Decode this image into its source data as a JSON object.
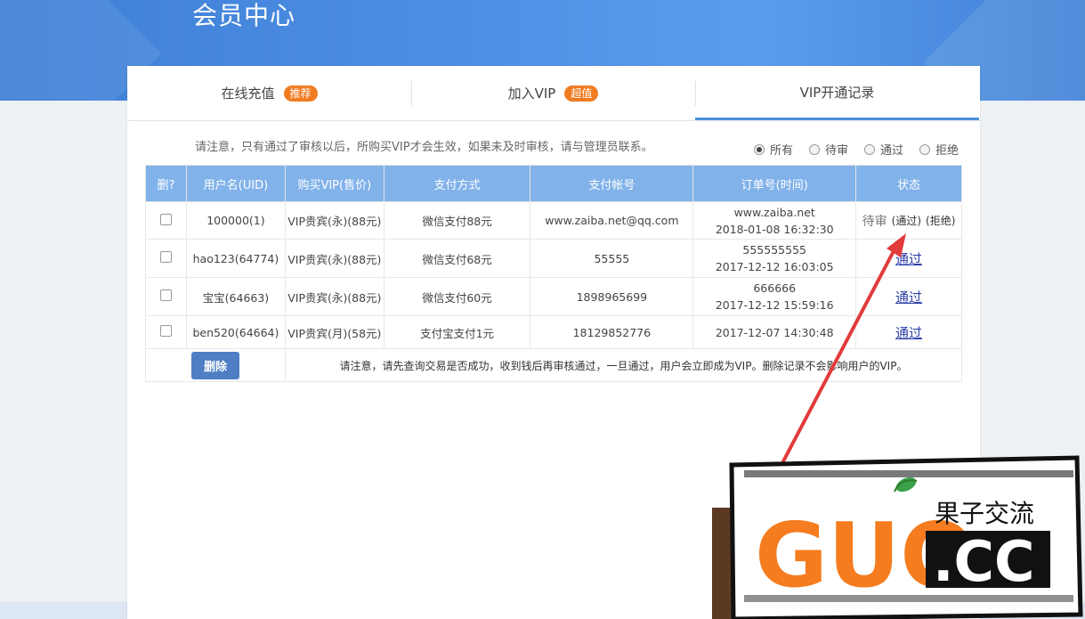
{
  "header": {
    "title": "会员中心"
  },
  "tabs": [
    {
      "label": "在线充值",
      "badge": "推荐"
    },
    {
      "label": "加入VIP",
      "badge": "超值"
    },
    {
      "label": "VIP开通记录",
      "badge": ""
    }
  ],
  "notice": "请注意，只有通过了审核以后，所购买VIP才会生效，如果未及时审核，请与管理员联系。",
  "filters": [
    {
      "label": "所有",
      "selected": true
    },
    {
      "label": "待审",
      "selected": false
    },
    {
      "label": "通过",
      "selected": false
    },
    {
      "label": "拒绝",
      "selected": false
    }
  ],
  "table": {
    "headers": [
      "删?",
      "用户名(UID)",
      "购买VIP(售价)",
      "支付方式",
      "支付帐号",
      "订单号(时间)",
      "状态"
    ],
    "rows": [
      {
        "user": "100000(1)",
        "vip": "VIP贵宾(永)(88元)",
        "pay_method": "微信支付88元",
        "account": "www.zaiba.net@qq.com",
        "order_no": "www.zaiba.net",
        "order_time": "2018-01-08 16:32:30",
        "status": "待审",
        "action_pass": "(通过)",
        "action_reject": "(拒绝)"
      },
      {
        "user": "hao123(64774)",
        "vip": "VIP贵宾(永)(88元)",
        "pay_method": "微信支付68元",
        "account": "55555",
        "order_no": "555555555",
        "order_time": "2017-12-12 16:03:05",
        "status": "通过"
      },
      {
        "user": "宝宝(64663)",
        "vip": "VIP贵宾(永)(88元)",
        "pay_method": "微信支付60元",
        "account": "1898965699",
        "order_no": "666666",
        "order_time": "2017-12-12 15:59:16",
        "status": "通过"
      },
      {
        "user": "ben520(64664)",
        "vip": "VIP贵宾(月)(58元)",
        "pay_method": "支付宝支付1元",
        "account": "18129852776",
        "order_no": "",
        "order_time": "2017-12-07 14:30:48",
        "status": "通过"
      }
    ],
    "delete_label": "删除",
    "footer_note": "请注意，请先查询交易是否成功，收到钱后再审核通过，一旦通过，用户会立即成为VIP。删除记录不会影响用户的VIP。"
  },
  "watermark": {
    "text_big": "GUO",
    "text_cn": "果子交流",
    "text_domain": ".CC"
  },
  "colors": {
    "banner": "#4e90e4",
    "table_header": "#81b2ea",
    "badge": "#f07c22",
    "delete_button": "#4f7ec4",
    "arrow": "#e23b3b"
  }
}
